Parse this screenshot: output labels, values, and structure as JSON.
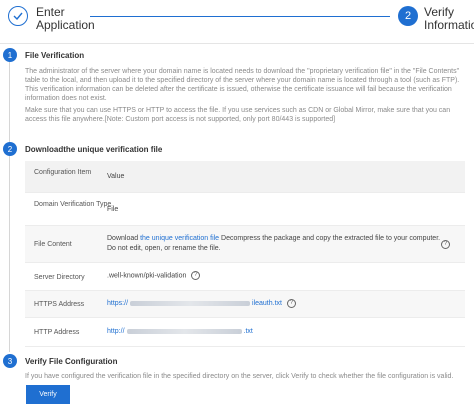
{
  "steps": [
    {
      "number": "",
      "label": "Enter Application",
      "state": "done"
    },
    {
      "number": "2",
      "label": "Verify Information",
      "state": "active"
    }
  ],
  "sections": [
    {
      "number": "1",
      "title": "File Verification",
      "paragraphs": [
        "The administrator of the server where your domain name is located needs to download the \"proprietary verification file\" in the \"File Contents\" table to the local, and then upload it to the specified directory of the server where your domain name is located through a tool (such as FTP). This verification information can be deleted after the certificate is issued, otherwise the certificate issuance will fail because the verification information does not exist.",
        "Make sure that you can use HTTPS or HTTP to access the file. If you use services such as CDN or Global Mirror, make sure that you can access this file anywhere.[Note: Custom port access is not supported, only port 80/443 is supported]"
      ]
    },
    {
      "number": "2",
      "title": "Downloadthe unique verification file"
    },
    {
      "number": "3",
      "title": "Verify File Configuration",
      "text": "If you have configured the verification file in the specified directory on the server, click Verify to check whether the file configuration is valid."
    }
  ],
  "table": {
    "headers": [
      "Configuration Item",
      "Value"
    ],
    "rows": {
      "domain_type": {
        "key": "Domain Verification Type",
        "value": "File"
      },
      "file_content": {
        "key": "File Content",
        "pre": "Download ",
        "link": "the unique verification file",
        "post": " Decompress the package and copy the extracted file to your computer. Do not edit, open, or rename the file."
      },
      "server_dir": {
        "key": "Server Directory",
        "value": ".well-known/pki-validation"
      },
      "https": {
        "key": "HTTPS Address",
        "prefix": "https://",
        "suffix": "ileauth.txt"
      },
      "http": {
        "key": "HTTP Address",
        "prefix": "http://",
        "suffix": ".txt"
      }
    }
  },
  "verify_button": "Verify",
  "colors": {
    "accent": "#1f6fd1",
    "muted_text": "#8a8a8a",
    "header_bg": "#f2f2f2"
  },
  "icons": {
    "help": "question-circle-icon",
    "done": "check-icon"
  }
}
